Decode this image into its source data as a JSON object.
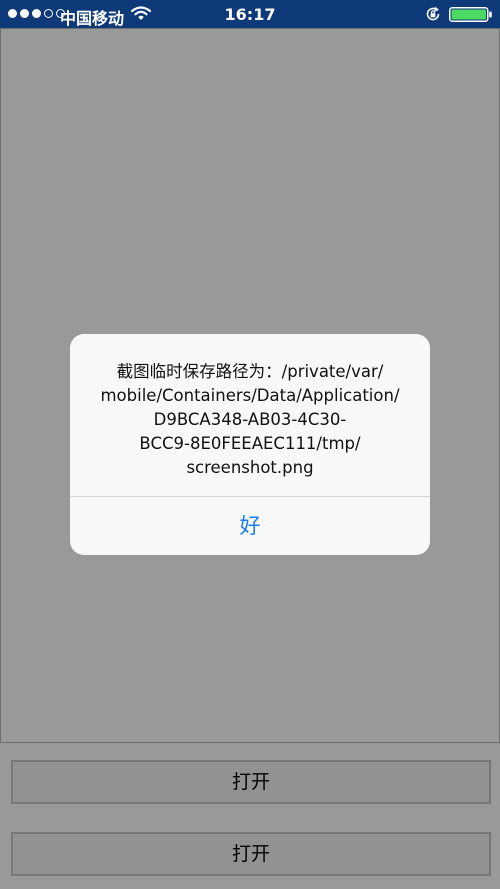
{
  "status_bar": {
    "carrier": "中国移动",
    "time": "16:17",
    "signal_bars_filled": 3,
    "signal_bars_total": 5,
    "battery_level": 1.0,
    "icons": [
      "signal-dots-icon",
      "wifi-icon",
      "rotation-lock-icon",
      "battery-icon"
    ]
  },
  "alert": {
    "message_lines": [
      "截图临时保存路径为：/private/var/",
      "mobile/Containers/Data/Application/",
      "D9BCA348-AB03-4C30-",
      "BCC9-8E0FEEAEC111/tmp/",
      "screenshot.png"
    ],
    "ok_label": "好"
  },
  "buttons": {
    "open_1": "打开",
    "open_2": "打开"
  },
  "colors": {
    "status_bar_bg": "#0f3a7a",
    "accent": "#1a7ef0",
    "battery_fill": "#4cd964"
  }
}
